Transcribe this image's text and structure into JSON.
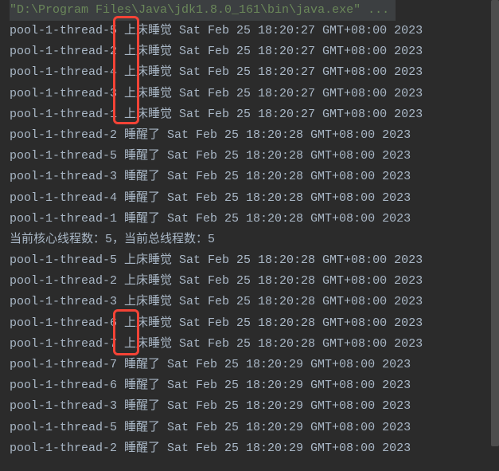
{
  "header": {
    "path_quoted": "\"D:\\Program Files\\Java\\jdk1.8.0_161\\bin\\java.exe\" ..."
  },
  "lines": [
    "pool-1-thread-5 上床睡觉 Sat Feb 25 18:20:27 GMT+08:00 2023",
    "pool-1-thread-2 上床睡觉 Sat Feb 25 18:20:27 GMT+08:00 2023",
    "pool-1-thread-4 上床睡觉 Sat Feb 25 18:20:27 GMT+08:00 2023",
    "pool-1-thread-3 上床睡觉 Sat Feb 25 18:20:27 GMT+08:00 2023",
    "pool-1-thread-1 上床睡觉 Sat Feb 25 18:20:27 GMT+08:00 2023",
    "pool-1-thread-2 睡醒了 Sat Feb 25 18:20:28 GMT+08:00 2023",
    "pool-1-thread-5 睡醒了 Sat Feb 25 18:20:28 GMT+08:00 2023",
    "pool-1-thread-3 睡醒了 Sat Feb 25 18:20:28 GMT+08:00 2023",
    "pool-1-thread-4 睡醒了 Sat Feb 25 18:20:28 GMT+08:00 2023",
    "pool-1-thread-1 睡醒了 Sat Feb 25 18:20:28 GMT+08:00 2023",
    "当前核心线程数：5，当前总线程数：5",
    "pool-1-thread-5 上床睡觉 Sat Feb 25 18:20:28 GMT+08:00 2023",
    "pool-1-thread-2 上床睡觉 Sat Feb 25 18:20:28 GMT+08:00 2023",
    "pool-1-thread-3 上床睡觉 Sat Feb 25 18:20:28 GMT+08:00 2023",
    "pool-1-thread-6 上床睡觉 Sat Feb 25 18:20:28 GMT+08:00 2023",
    "pool-1-thread-7 上床睡觉 Sat Feb 25 18:20:28 GMT+08:00 2023",
    "pool-1-thread-7 睡醒了 Sat Feb 25 18:20:29 GMT+08:00 2023",
    "pool-1-thread-6 睡醒了 Sat Feb 25 18:20:29 GMT+08:00 2023",
    "pool-1-thread-3 睡醒了 Sat Feb 25 18:20:29 GMT+08:00 2023",
    "pool-1-thread-5 睡醒了 Sat Feb 25 18:20:29 GMT+08:00 2023",
    "pool-1-thread-2 睡醒了 Sat Feb 25 18:20:29 GMT+08:00 2023"
  ]
}
